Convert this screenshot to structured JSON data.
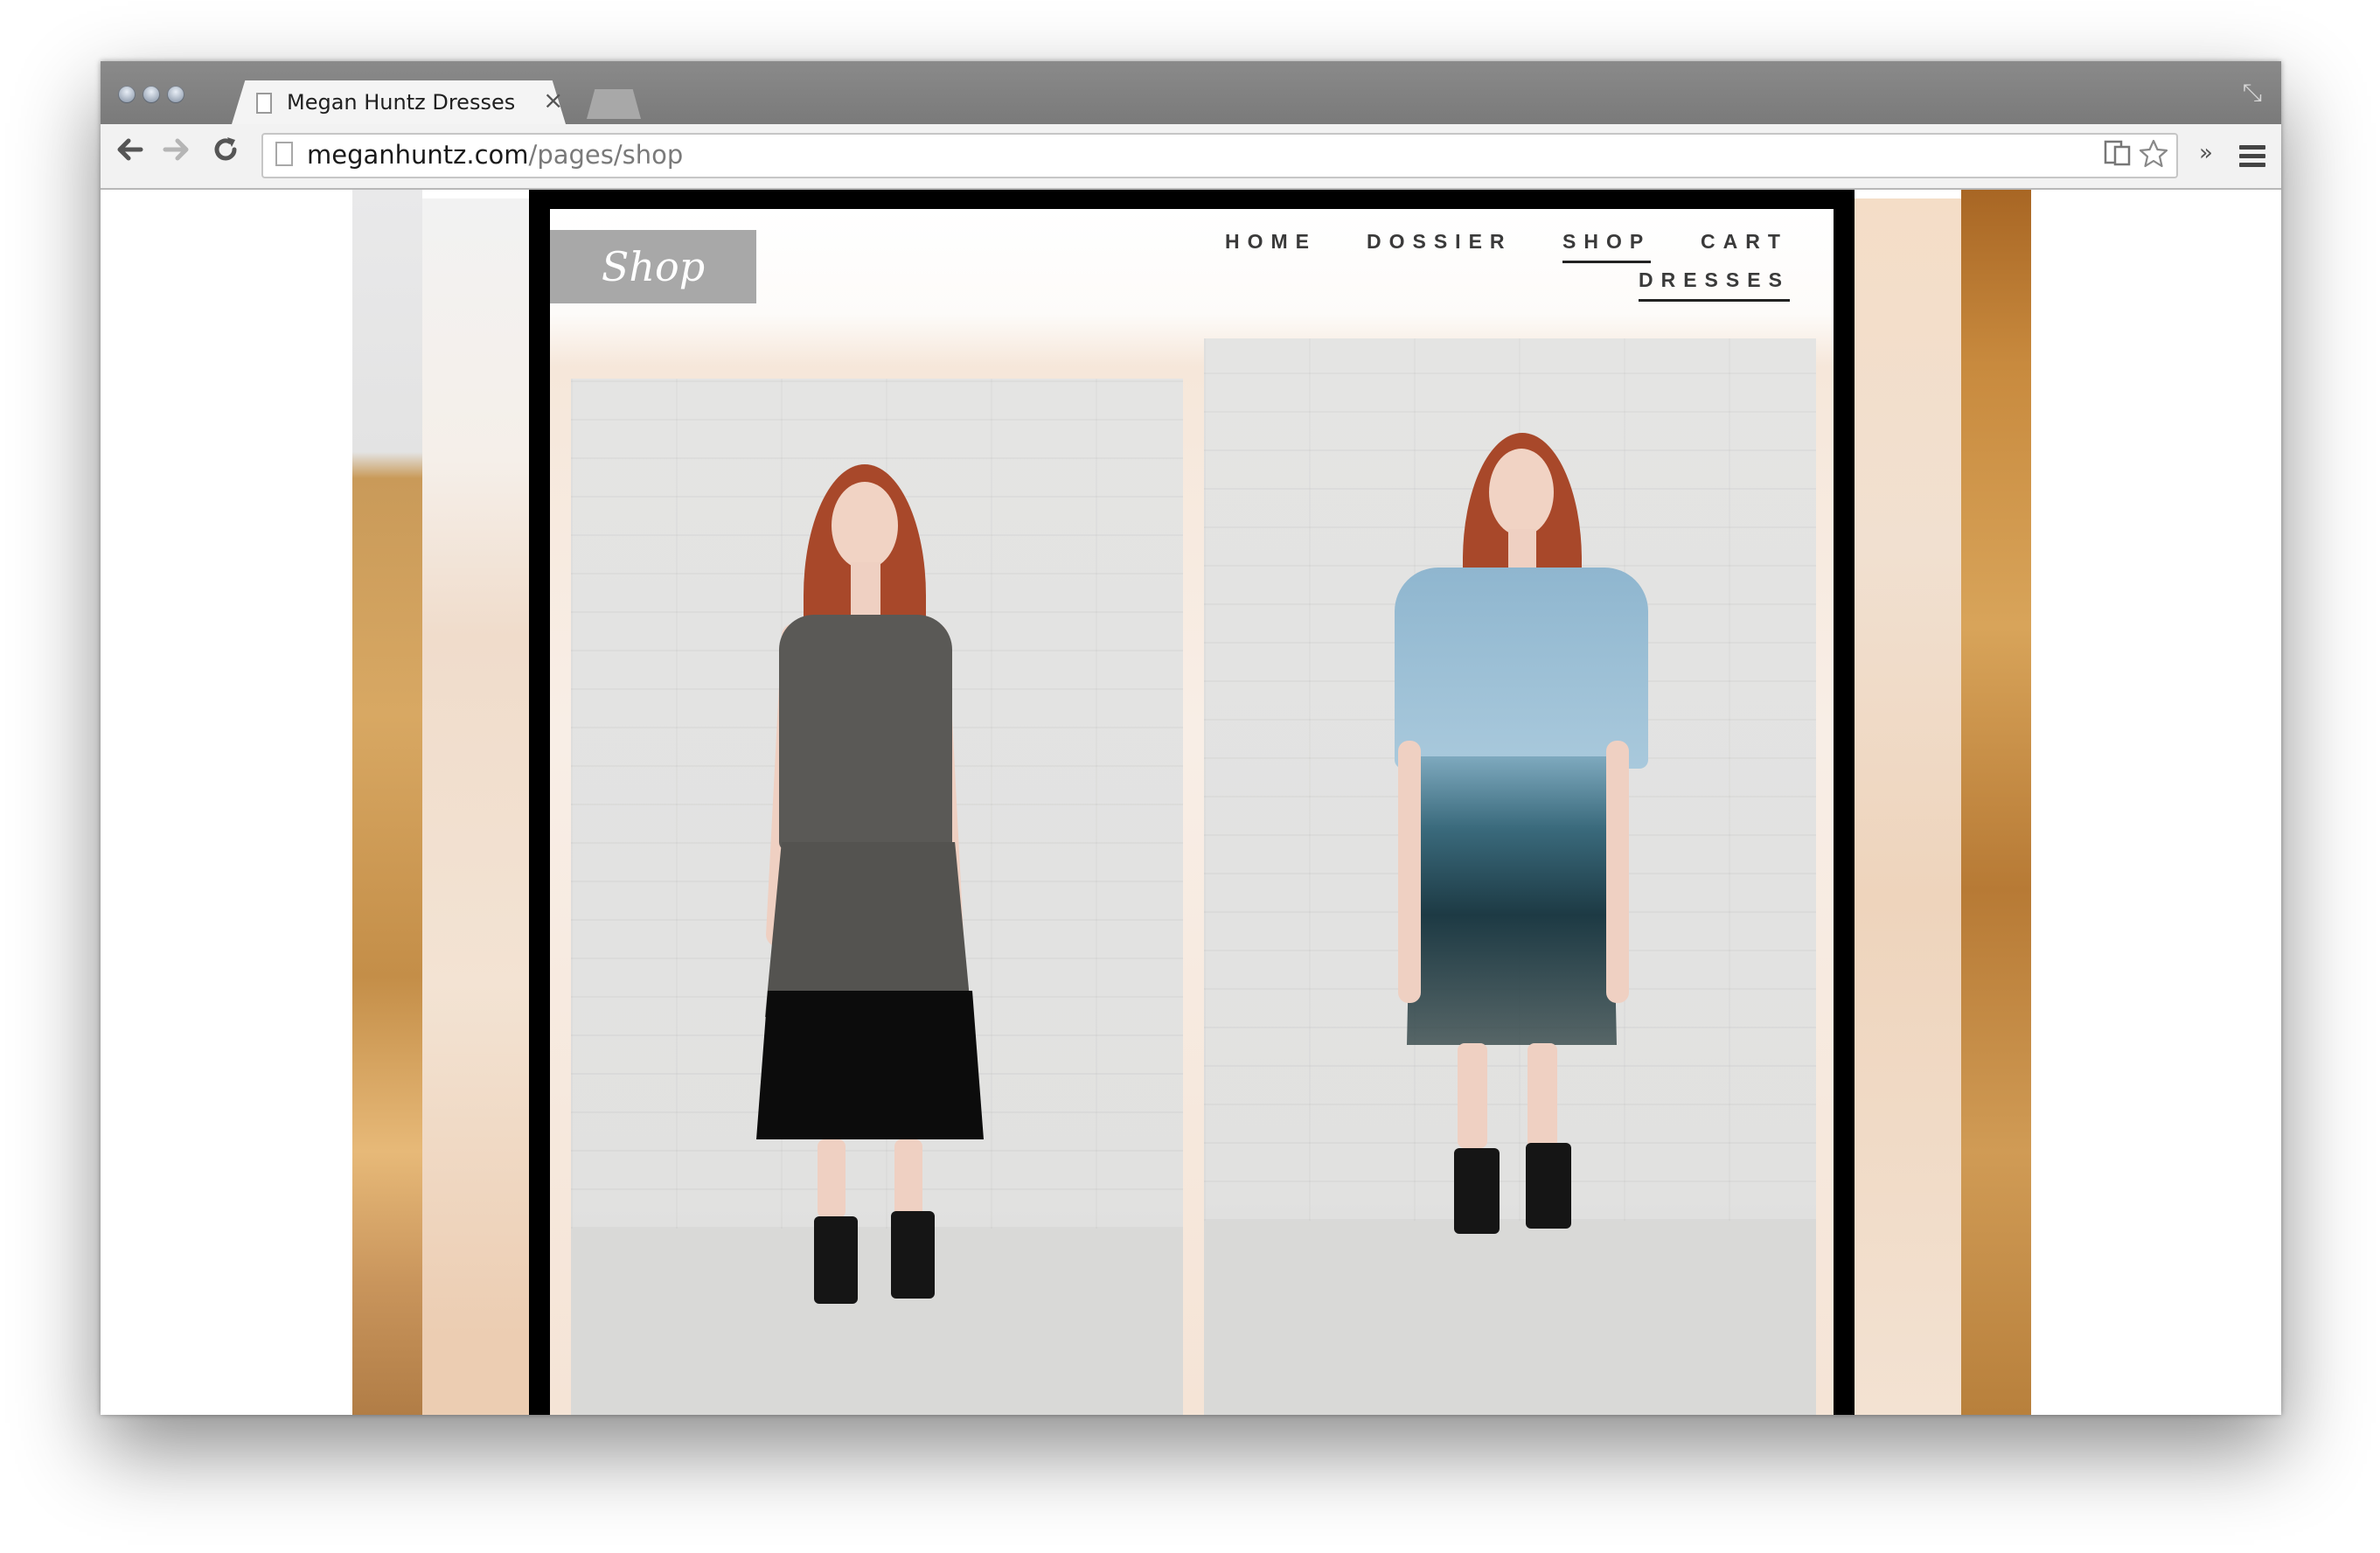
{
  "browser": {
    "tab": {
      "title": "Megan Huntz Dresses",
      "close_glyph": "×"
    },
    "toolbar": {
      "back_icon": "arrow-left-icon",
      "forward_icon": "arrow-right-icon",
      "reload_icon": "reload-icon",
      "url_host": "meganhuntz.com",
      "url_path": "/pages/shop",
      "extensions_glyph": "»"
    }
  },
  "page": {
    "section_label": "Shop",
    "nav": {
      "home": "HOME",
      "dossier": "DOSSIER",
      "shop": "SHOP",
      "cart": "CART",
      "dresses": "DRESSES"
    },
    "products": [
      {
        "name": "dress-photo-grey-black",
        "dress_colors": [
          "#5a5956",
          "#0c0c0c"
        ]
      },
      {
        "name": "dress-photo-blue-ombre",
        "dress_colors": [
          "#8fb6cf",
          "#1d3a44"
        ]
      }
    ]
  },
  "colors": {
    "chrome_frame": "#7f7f7f",
    "toolbar": "#f2f2f2",
    "shop_label_bg": "#a8a8a8",
    "content_frame": "#000000"
  }
}
